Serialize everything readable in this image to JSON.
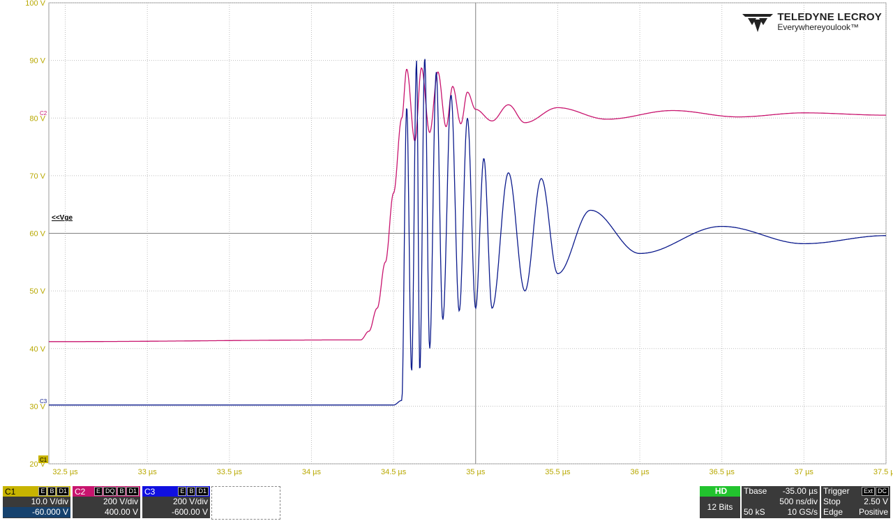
{
  "chart_data": {
    "type": "line",
    "title": "",
    "xlabel": "",
    "ylabel": "",
    "xlim": [
      32.4,
      37.5
    ],
    "ylim": [
      20,
      100
    ],
    "x_ticks": [
      "32.5 µs",
      "33 µs",
      "33.5 µs",
      "34 µs",
      "34.5 µs",
      "35 µs",
      "35.5 µs",
      "36 µs",
      "36.5 µs",
      "37 µs",
      "37.5 µs"
    ],
    "x_tick_values": [
      32.5,
      33,
      33.5,
      34,
      34.5,
      35,
      35.5,
      36,
      36.5,
      37,
      37.5
    ],
    "y_ticks": [
      "100 V",
      "90 V",
      "80 V",
      "70 V",
      "60 V",
      "50 V",
      "40 V",
      "30 V",
      "20 V"
    ],
    "y_tick_values": [
      100,
      90,
      80,
      70,
      60,
      50,
      40,
      30,
      20
    ],
    "grid": true,
    "series": [
      {
        "name": "C2",
        "color": "#c8146e",
        "description": "step from ~41.5 V to ~80.5 V, damped ringing",
        "x": [
          32.4,
          34.3,
          34.35,
          34.4,
          34.45,
          34.5,
          34.55,
          34.58,
          34.63,
          34.67,
          34.72,
          34.77,
          34.82,
          34.86,
          34.91,
          34.95,
          35.0,
          35.1,
          35.2,
          35.3,
          35.5,
          35.8,
          36.2,
          36.6,
          37.0,
          37.5
        ],
        "values": [
          41.2,
          41.5,
          43.0,
          47.0,
          55.0,
          67.0,
          80.0,
          88.5,
          76.0,
          88.7,
          77.5,
          88.0,
          78.5,
          85.5,
          79.0,
          84.5,
          81.5,
          79.5,
          82.3,
          79.2,
          81.8,
          79.8,
          81.3,
          80.2,
          80.9,
          80.5
        ]
      },
      {
        "name": "C3",
        "color": "#0b1a8c",
        "description": "step from ~30 V to ~59.5 V, strong damped ringing",
        "x": [
          32.4,
          34.5,
          34.55,
          34.58,
          34.61,
          34.64,
          34.66,
          34.69,
          34.72,
          34.76,
          34.8,
          34.85,
          34.9,
          34.95,
          35.0,
          35.05,
          35.1,
          35.2,
          35.3,
          35.4,
          35.5,
          35.7,
          36.0,
          36.5,
          37.0,
          37.5
        ],
        "values": [
          30.2,
          30.2,
          31.0,
          82.0,
          36.0,
          90.0,
          36.0,
          90.5,
          40.0,
          88.0,
          45.0,
          84.0,
          46.5,
          80.0,
          47.0,
          73.0,
          47.0,
          70.5,
          50.0,
          69.5,
          53.0,
          64.0,
          56.5,
          61.2,
          58.2,
          59.6
        ]
      }
    ]
  },
  "screen": {
    "logo_line1": "TELEDYNE LECROY",
    "logo_line2": "Everywhereyoulook™",
    "ref_marker": "<<Vge",
    "trace_tag_c2": "C2",
    "trace_tag_c3": "C3",
    "trace_tag_c1": "C1"
  },
  "channels": [
    {
      "id": "C1",
      "flags": [
        "E",
        "B",
        "D1"
      ],
      "scale": "10.0 V/div",
      "offset": "-60.000 V",
      "color": "#c8b400"
    },
    {
      "id": "C2",
      "flags": [
        "E",
        "DQ",
        "B",
        "D1"
      ],
      "scale": "200 V/div",
      "offset": "400.00 V",
      "color": "#c8146e"
    },
    {
      "id": "C3",
      "flags": [
        "E",
        "B",
        "D1"
      ],
      "scale": "200 V/div",
      "offset": "-600.00 V",
      "color": "#1010e0"
    }
  ],
  "hd": {
    "label": "HD",
    "bits": "12 Bits"
  },
  "timebase": {
    "label": "Tbase",
    "delay": "-35.00 µs",
    "per_div": "500 ns/div",
    "samples": "50 kS",
    "rate": "10 GS/s"
  },
  "trigger": {
    "label": "Trigger",
    "badge1": "Ext",
    "badge2": "DC",
    "state": "Stop",
    "level": "2.50 V",
    "type": "Edge",
    "slope": "Positive"
  }
}
